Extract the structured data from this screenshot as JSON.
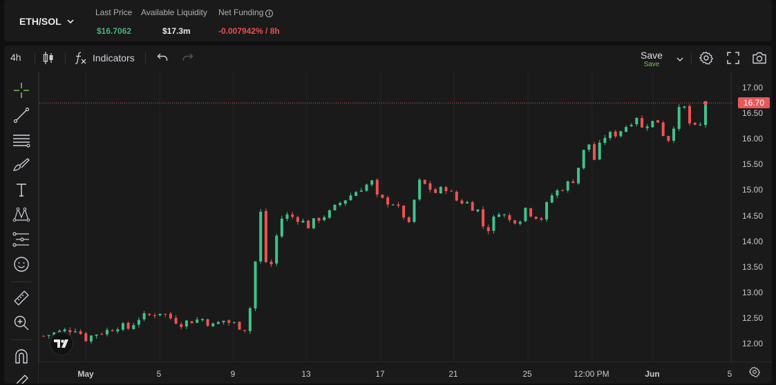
{
  "header": {
    "pair": "ETH/SOL",
    "stats": [
      {
        "label": "Last Price",
        "value": "$16.7062",
        "color": "green"
      },
      {
        "label": "Available Liquidity",
        "value": "$17.3m",
        "color": "white"
      },
      {
        "label": "Net Funding",
        "value": "-0.007942% / 8h",
        "color": "red"
      }
    ]
  },
  "toolbar": {
    "interval": "4h",
    "indicators_label": "Indicators",
    "save_label": "Save",
    "save_sub": "Save"
  },
  "icons": {
    "left_tools": [
      "crosshair-icon",
      "trend-line-icon",
      "fib-lines-icon",
      "brush-icon",
      "text-icon",
      "pattern-icon",
      "projection-icon",
      "emoji-icon",
      "ruler-icon",
      "zoom-in-icon",
      "magnet-icon",
      "pencil-lock-icon"
    ],
    "toolbar": [
      "candles-icon",
      "fx-icon",
      "chevron-down-icon",
      "undo-icon",
      "redo-icon",
      "settings-icon",
      "fullscreen-icon",
      "camera-icon"
    ]
  },
  "colors": {
    "up": "#26a69a",
    "up_bright": "#3fc38a",
    "down": "#ef5350",
    "price_tag": "#e5595b"
  },
  "price_tag": "16.70",
  "chart_data": {
    "type": "candlestick",
    "interval": "4h",
    "y_ticks": [
      "17.00",
      "16.50",
      "16.00",
      "15.50",
      "15.00",
      "14.50",
      "14.00",
      "13.50",
      "13.00",
      "12.50",
      "12.00"
    ],
    "x_ticks": [
      "May",
      "5",
      "9",
      "13",
      "17",
      "21",
      "25",
      "12:00 PM",
      "Jun",
      "5"
    ],
    "ylim": [
      11.6,
      17.25
    ],
    "last_price": 16.7,
    "close_path": [
      [
        0,
        12.15
      ],
      [
        4,
        12.25
      ],
      [
        6,
        12.3
      ],
      [
        8,
        12.1
      ],
      [
        10,
        12.2
      ],
      [
        12,
        12.25
      ],
      [
        14,
        12.35
      ],
      [
        16,
        12.3
      ],
      [
        18,
        12.5
      ],
      [
        20,
        12.55
      ],
      [
        22,
        12.62
      ],
      [
        24,
        12.5
      ],
      [
        26,
        12.4
      ],
      [
        28,
        12.45
      ],
      [
        30,
        12.48
      ],
      [
        32,
        12.35
      ],
      [
        34,
        12.45
      ],
      [
        36,
        12.38
      ],
      [
        38,
        12.3
      ],
      [
        39,
        12.7
      ],
      [
        40,
        13.6
      ],
      [
        41,
        14.55
      ],
      [
        42,
        13.6
      ],
      [
        43,
        13.55
      ],
      [
        44,
        14.1
      ],
      [
        45,
        14.45
      ],
      [
        46,
        14.5
      ],
      [
        48,
        14.45
      ],
      [
        50,
        14.3
      ],
      [
        52,
        14.45
      ],
      [
        54,
        14.55
      ],
      [
        56,
        14.75
      ],
      [
        58,
        14.9
      ],
      [
        60,
        15.05
      ],
      [
        62,
        15.15
      ],
      [
        63,
        14.85
      ],
      [
        64,
        14.8
      ],
      [
        66,
        14.75
      ],
      [
        68,
        14.5
      ],
      [
        69,
        14.3
      ],
      [
        70,
        14.8
      ],
      [
        71,
        15.15
      ],
      [
        72,
        15.1
      ],
      [
        74,
        14.95
      ],
      [
        76,
        15.05
      ],
      [
        78,
        14.8
      ],
      [
        80,
        14.75
      ],
      [
        82,
        14.6
      ],
      [
        83,
        14.3
      ],
      [
        84,
        14.25
      ],
      [
        86,
        14.6
      ],
      [
        88,
        14.4
      ],
      [
        90,
        14.45
      ],
      [
        91,
        14.65
      ],
      [
        92,
        14.55
      ],
      [
        94,
        14.45
      ],
      [
        95,
        14.7
      ],
      [
        96,
        14.9
      ],
      [
        98,
        15.05
      ],
      [
        100,
        15.2
      ],
      [
        101,
        15.45
      ],
      [
        102,
        15.75
      ],
      [
        103,
        15.9
      ],
      [
        104,
        15.6
      ],
      [
        105,
        15.85
      ],
      [
        106,
        16.05
      ],
      [
        108,
        16.1
      ],
      [
        110,
        16.25
      ],
      [
        112,
        16.45
      ],
      [
        113,
        16.2
      ],
      [
        114,
        16.3
      ],
      [
        116,
        16.35
      ],
      [
        117,
        16.1
      ],
      [
        118,
        16.0
      ],
      [
        120,
        16.55
      ],
      [
        121,
        16.6
      ],
      [
        122,
        16.3
      ],
      [
        123,
        16.2
      ],
      [
        124,
        16.25
      ],
      [
        125,
        16.7
      ]
    ],
    "candle_count": 126
  }
}
